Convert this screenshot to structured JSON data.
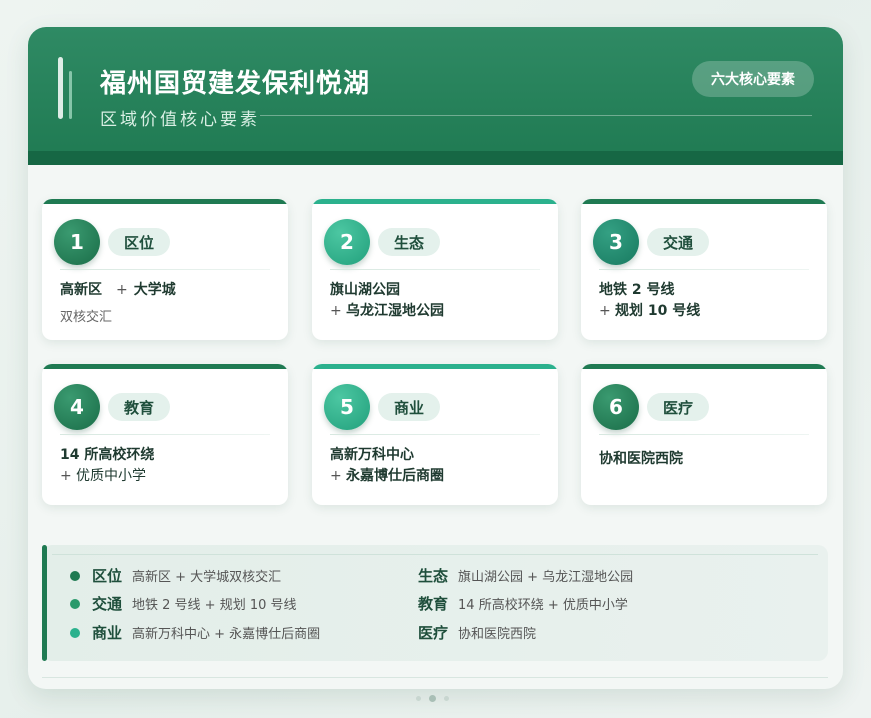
{
  "header": {
    "title": "福州国贸建发保利悦湖",
    "subtitle": "区域价值核心要素",
    "pill": "六大核心要素"
  },
  "colors": {
    "primary": "#1f7a52",
    "teal": "#2bb18d",
    "dark": "#166744"
  },
  "cards": [
    {
      "num": "1",
      "tag": "区位",
      "line1a": "高新区",
      "line1b": "大学城",
      "note": "双核交汇"
    },
    {
      "num": "2",
      "tag": "生态",
      "line1": "旗山湖公园",
      "line2": "乌龙江湿地公园"
    },
    {
      "num": "3",
      "tag": "交通",
      "line1": "地铁 2 号线",
      "line2": "规划 10 号线"
    },
    {
      "num": "4",
      "tag": "教育",
      "line1": "14 所高校环绕",
      "line2": "优质中小学"
    },
    {
      "num": "5",
      "tag": "商业",
      "line1": "高新万科中心",
      "line2": "永嘉博仕后商圈"
    },
    {
      "num": "6",
      "tag": "医疗",
      "line1": "协和医院西院"
    }
  ],
  "plus_sign": "+",
  "summary": [
    {
      "key": "区位",
      "value": "高新区 + 大学城双核交汇"
    },
    {
      "key": "生态",
      "value": "旗山湖公园 + 乌龙江湿地公园"
    },
    {
      "key": "交通",
      "value": "地铁 2 号线 + 规划 10 号线"
    },
    {
      "key": "教育",
      "value": "14 所高校环绕 + 优质中小学"
    },
    {
      "key": "商业",
      "value": "高新万科中心 + 永嘉博仕后商圈"
    },
    {
      "key": "医疗",
      "value": "协和医院西院"
    }
  ]
}
